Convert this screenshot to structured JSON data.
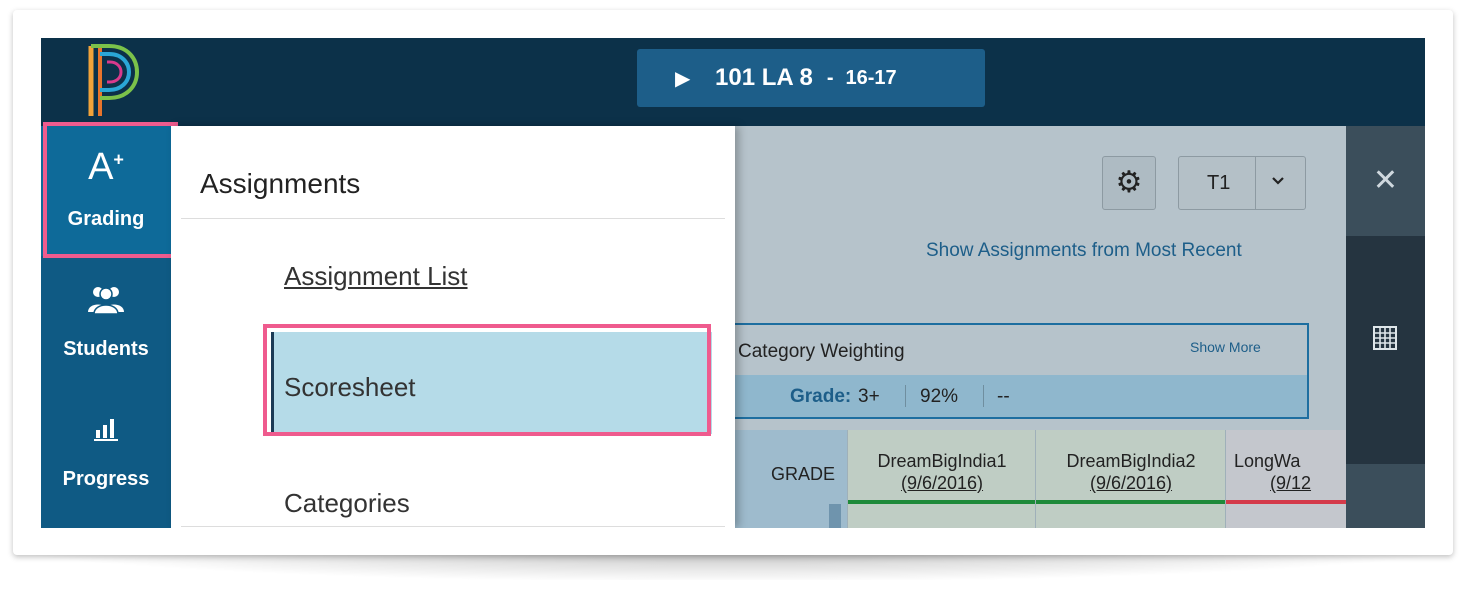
{
  "header": {
    "class_selector": {
      "play_icon": "play-icon",
      "name": "101 LA 8",
      "separator": "-",
      "term": "16-17"
    }
  },
  "leftnav": {
    "items": [
      {
        "label": "Grading",
        "icon": "grading-icon",
        "glyph": "A",
        "sup": "+",
        "active": true
      },
      {
        "label": "Students",
        "icon": "students-icon"
      },
      {
        "label": "Progress",
        "icon": "progress-icon"
      }
    ]
  },
  "menu": {
    "title": "Assignments",
    "items": [
      {
        "label": "Assignment List"
      },
      {
        "label": "Scoresheet",
        "selected": true
      },
      {
        "label": "Categories"
      }
    ]
  },
  "toolbar": {
    "term_value": "T1",
    "show_assignments_link": "Show Assignments from Most Recent"
  },
  "category_box": {
    "title": "Category Weighting",
    "show_more": "Show More",
    "grade_label": "Grade:",
    "grade_value": "3+",
    "percent": "92%",
    "dash": "--"
  },
  "scoresheet": {
    "grade_header": "GRADE",
    "columns": [
      {
        "name": "DreamBigIndia1",
        "date": "(9/6/2016)",
        "color": "#1e8a3a"
      },
      {
        "name": "DreamBigIndia2",
        "date": "(9/6/2016)",
        "color": "#1e8a3a"
      },
      {
        "name": "LongWa",
        "date": "(9/12",
        "color": "#d43a4a"
      }
    ]
  },
  "colors": {
    "topbar": "#0c3149",
    "accent": "#1d5e89",
    "highlight": "#ef5b8e"
  }
}
